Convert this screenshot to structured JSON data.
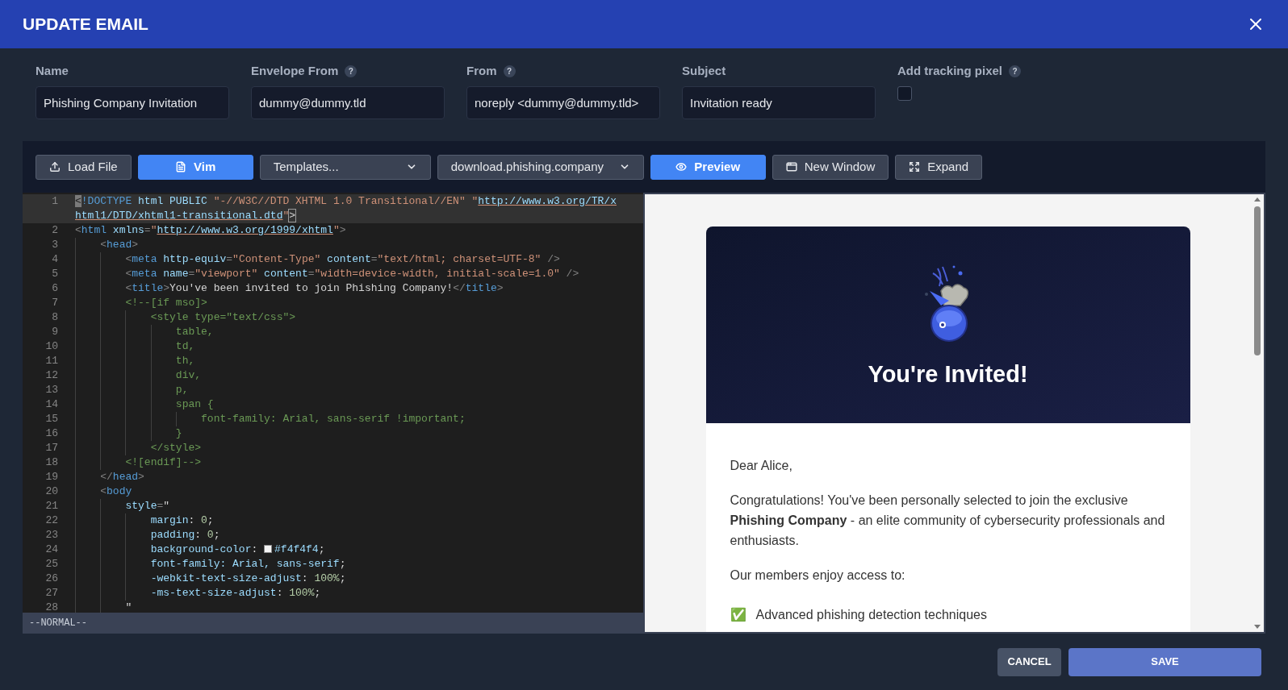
{
  "dialog": {
    "title": "UPDATE EMAIL"
  },
  "fields": [
    {
      "label": "Name",
      "help": false,
      "kind": "text",
      "value": "Phishing Company Invitation"
    },
    {
      "label": "Envelope From",
      "help": true,
      "kind": "text",
      "value": "dummy@dummy.tld"
    },
    {
      "label": "From",
      "help": true,
      "kind": "text",
      "value": "noreply <dummy@dummy.tld>"
    },
    {
      "label": "Subject",
      "help": false,
      "kind": "text",
      "value": "Invitation ready"
    },
    {
      "label": "Add tracking pixel",
      "help": true,
      "kind": "checkbox",
      "checked": false
    }
  ],
  "help_mark": "?",
  "toolbar": [
    {
      "kind": "button",
      "label": "Load File",
      "active": false
    },
    {
      "kind": "button",
      "label": "Vim",
      "active": true
    },
    {
      "kind": "select",
      "label": "Templates..."
    },
    {
      "kind": "select",
      "label": "download.phishing.company"
    },
    {
      "kind": "button",
      "label": "Preview",
      "active": true
    },
    {
      "kind": "button",
      "label": "New Window",
      "active": false
    },
    {
      "kind": "button",
      "label": "Expand",
      "active": false
    }
  ],
  "editor": {
    "lines": [
      {
        "no": "1",
        "current": true,
        "tokens": [
          {
            "kind": "cursor",
            "text": "<"
          },
          {
            "kind": "tag",
            "text": "!DOCTYPE"
          },
          {
            "kind": "attr",
            "text": " html PUBLIC "
          },
          {
            "kind": "str",
            "text": "\"-//W3C//DTD XHTML 1.0 Transitional//EN\" \""
          },
          {
            "kind": "url",
            "text": "http://www.w3.org/TR/xhtml1/DTD/xhtml1-transitional.dtd"
          },
          {
            "kind": "str",
            "text": "\""
          },
          {
            "kind": "match",
            "text": ">"
          }
        ]
      },
      {
        "no": "2",
        "current": false,
        "tokens": [
          {
            "kind": "punct",
            "text": "<"
          },
          {
            "kind": "tag",
            "text": "html"
          },
          {
            "kind": "attr",
            "text": " xmlns"
          },
          {
            "kind": "punct",
            "text": "="
          },
          {
            "kind": "str",
            "text": "\""
          },
          {
            "kind": "url",
            "text": "http://www.w3.org/1999/xhtml"
          },
          {
            "kind": "str",
            "text": "\""
          },
          {
            "kind": "punct",
            "text": ">"
          }
        ]
      },
      {
        "no": "3",
        "current": false,
        "tokens": [
          {
            "kind": "punct",
            "text": "    <"
          },
          {
            "kind": "tag",
            "text": "head"
          },
          {
            "kind": "punct",
            "text": ">"
          }
        ]
      },
      {
        "no": "4",
        "current": false,
        "tokens": [
          {
            "kind": "punct",
            "text": "        <"
          },
          {
            "kind": "tag",
            "text": "meta"
          },
          {
            "kind": "attr",
            "text": " http-equiv"
          },
          {
            "kind": "punct",
            "text": "="
          },
          {
            "kind": "str",
            "text": "\"Content-Type\""
          },
          {
            "kind": "attr",
            "text": " content"
          },
          {
            "kind": "punct",
            "text": "="
          },
          {
            "kind": "str",
            "text": "\"text/html; charset=UTF-8\""
          },
          {
            "kind": "punct",
            "text": " />"
          }
        ]
      },
      {
        "no": "5",
        "current": false,
        "tokens": [
          {
            "kind": "punct",
            "text": "        <"
          },
          {
            "kind": "tag",
            "text": "meta"
          },
          {
            "kind": "attr",
            "text": " name"
          },
          {
            "kind": "punct",
            "text": "="
          },
          {
            "kind": "str",
            "text": "\"viewport\""
          },
          {
            "kind": "attr",
            "text": " content"
          },
          {
            "kind": "punct",
            "text": "="
          },
          {
            "kind": "str",
            "text": "\"width=device-width, initial-scale=1.0\""
          },
          {
            "kind": "punct",
            "text": " />"
          }
        ]
      },
      {
        "no": "6",
        "current": false,
        "tokens": [
          {
            "kind": "punct",
            "text": "        <"
          },
          {
            "kind": "tag",
            "text": "title"
          },
          {
            "kind": "punct",
            "text": ">"
          },
          {
            "kind": "text",
            "text": "You've been invited to join Phishing Company!"
          },
          {
            "kind": "punct",
            "text": "</"
          },
          {
            "kind": "tag",
            "text": "title"
          },
          {
            "kind": "punct",
            "text": ">"
          }
        ]
      },
      {
        "no": "7",
        "current": false,
        "tokens": [
          {
            "kind": "comment",
            "text": "        <!--[if mso]>"
          }
        ]
      },
      {
        "no": "8",
        "current": false,
        "tokens": [
          {
            "kind": "comment",
            "text": "            <style type=\"text/css\">"
          }
        ]
      },
      {
        "no": "9",
        "current": false,
        "tokens": [
          {
            "kind": "comment",
            "text": "                table,"
          }
        ]
      },
      {
        "no": "10",
        "current": false,
        "tokens": [
          {
            "kind": "comment",
            "text": "                td,"
          }
        ]
      },
      {
        "no": "11",
        "current": false,
        "tokens": [
          {
            "kind": "comment",
            "text": "                th,"
          }
        ]
      },
      {
        "no": "12",
        "current": false,
        "tokens": [
          {
            "kind": "comment",
            "text": "                div,"
          }
        ]
      },
      {
        "no": "13",
        "current": false,
        "tokens": [
          {
            "kind": "comment",
            "text": "                p,"
          }
        ]
      },
      {
        "no": "14",
        "current": false,
        "tokens": [
          {
            "kind": "comment",
            "text": "                span {"
          }
        ]
      },
      {
        "no": "15",
        "current": false,
        "tokens": [
          {
            "kind": "comment",
            "text": "                    font-family: Arial, sans-serif !important;"
          }
        ]
      },
      {
        "no": "16",
        "current": false,
        "tokens": [
          {
            "kind": "comment",
            "text": "                }"
          }
        ]
      },
      {
        "no": "17",
        "current": false,
        "tokens": [
          {
            "kind": "comment",
            "text": "            </style>"
          }
        ]
      },
      {
        "no": "18",
        "current": false,
        "tokens": [
          {
            "kind": "comment",
            "text": "        <![endif]-->"
          }
        ]
      },
      {
        "no": "19",
        "current": false,
        "tokens": [
          {
            "kind": "punct",
            "text": "    </"
          },
          {
            "kind": "tag",
            "text": "head"
          },
          {
            "kind": "punct",
            "text": ">"
          }
        ]
      },
      {
        "no": "20",
        "current": false,
        "tokens": [
          {
            "kind": "punct",
            "text": "    <"
          },
          {
            "kind": "tag",
            "text": "body"
          }
        ]
      },
      {
        "no": "21",
        "current": false,
        "tokens": [
          {
            "kind": "attr",
            "text": "        style"
          },
          {
            "kind": "punct",
            "text": "="
          },
          {
            "kind": "text",
            "text": "\""
          }
        ]
      },
      {
        "no": "22",
        "current": false,
        "tokens": [
          {
            "kind": "attr",
            "text": "            margin"
          },
          {
            "kind": "text",
            "text": ": "
          },
          {
            "kind": "num",
            "text": "0"
          },
          {
            "kind": "text",
            "text": ";"
          }
        ]
      },
      {
        "no": "23",
        "current": false,
        "tokens": [
          {
            "kind": "attr",
            "text": "            padding"
          },
          {
            "kind": "text",
            "text": ": "
          },
          {
            "kind": "num",
            "text": "0"
          },
          {
            "kind": "text",
            "text": ";"
          }
        ]
      },
      {
        "no": "24",
        "current": false,
        "tokens": [
          {
            "kind": "attr",
            "text": "            background-color"
          },
          {
            "kind": "text",
            "text": ": "
          },
          {
            "kind": "swatch",
            "color": "#f4f4f4"
          },
          {
            "kind": "attr",
            "text": "#f4f4f4"
          },
          {
            "kind": "text",
            "text": ";"
          }
        ]
      },
      {
        "no": "25",
        "current": false,
        "tokens": [
          {
            "kind": "attr",
            "text": "            font-family: Arial, sans-serif"
          },
          {
            "kind": "text",
            "text": ";"
          }
        ]
      },
      {
        "no": "26",
        "current": false,
        "tokens": [
          {
            "kind": "attr",
            "text": "            -webkit-text-size-adjust"
          },
          {
            "kind": "text",
            "text": ": "
          },
          {
            "kind": "num",
            "text": "100%"
          },
          {
            "kind": "text",
            "text": ";"
          }
        ]
      },
      {
        "no": "27",
        "current": false,
        "tokens": [
          {
            "kind": "attr",
            "text": "            -ms-text-size-adjust"
          },
          {
            "kind": "text",
            "text": ": "
          },
          {
            "kind": "num",
            "text": "100%"
          },
          {
            "kind": "text",
            "text": ";"
          }
        ]
      },
      {
        "no": "28",
        "current": false,
        "tokens": [
          {
            "kind": "text",
            "text": "        \""
          }
        ]
      }
    ],
    "status": "--NORMAL--"
  },
  "preview": {
    "heading": "You're Invited!",
    "greeting": "Dear Alice,",
    "paragraphs": [
      "Congratulations! You've been personally selected to join the exclusive **Phishing Company** - an elite community of cybersecurity professionals and enthusiasts.",
      "Our members enjoy access to:"
    ],
    "list": [
      {
        "mark": "✅",
        "text": "Advanced phishing detection techniques"
      }
    ]
  },
  "footer": [
    {
      "kind": "secondary",
      "label": "CANCEL"
    },
    {
      "kind": "primary",
      "label": "SAVE"
    }
  ]
}
